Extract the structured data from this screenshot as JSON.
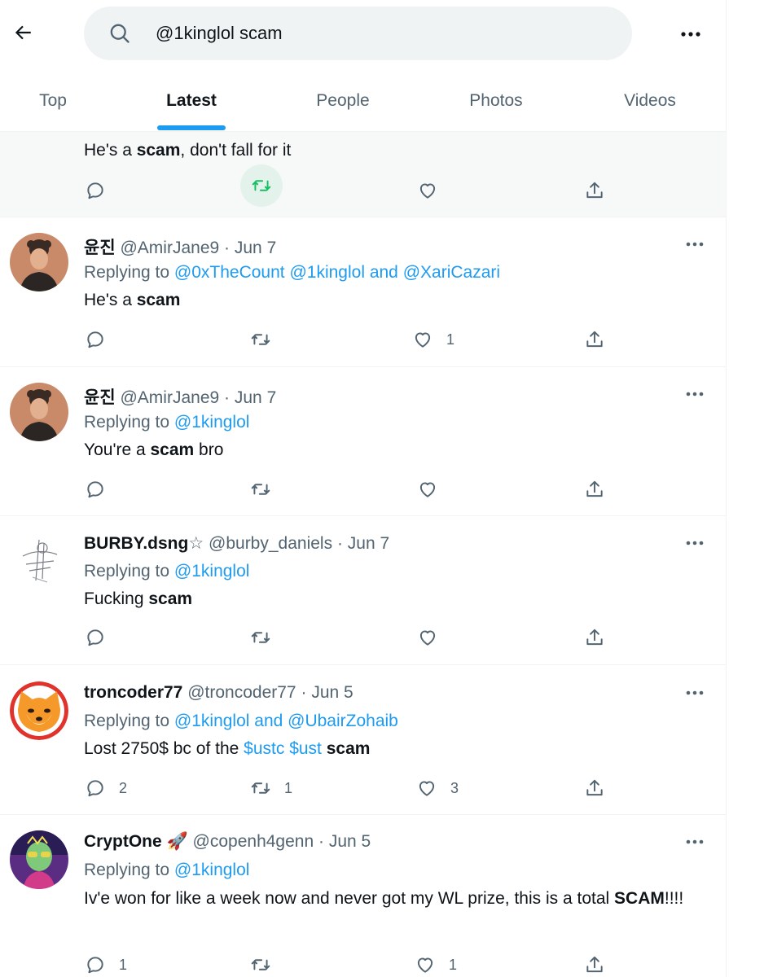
{
  "search": {
    "query": "@1kinglol scam"
  },
  "tabs": [
    "Top",
    "Latest",
    "People",
    "Photos",
    "Videos"
  ],
  "colors": {
    "accent": "#1d9bf0",
    "text": "#0f1419",
    "muted": "#536471",
    "retweet_hover": "#e3f3ec"
  },
  "icons": {
    "back": "arrow-left-icon",
    "search": "search-icon",
    "more": "more-horizontal-icon",
    "reply": "reply-icon",
    "retweet": "retweet-icon",
    "like": "heart-icon",
    "share": "share-icon"
  },
  "tweets": [
    {
      "id": "partial",
      "body": [
        {
          "t": "He's a "
        },
        {
          "b": "scam"
        },
        {
          "t": ", don't fall for it"
        }
      ],
      "counts": {
        "reply": "",
        "retweet": "",
        "like": ""
      }
    },
    {
      "name": "윤진",
      "handle": "@AmirJane9",
      "date": "Jun 7",
      "replying_prefix": "Replying to",
      "replying_to": "@0xTheCount @1kinglol and @XariCazari",
      "body": [
        {
          "t": "He's a "
        },
        {
          "b": "scam"
        }
      ],
      "counts": {
        "reply": "",
        "retweet": "",
        "like": "1"
      }
    },
    {
      "name": "윤진",
      "handle": "@AmirJane9",
      "date": "Jun 7",
      "replying_prefix": "Replying to",
      "replying_to": "@1kinglol",
      "body": [
        {
          "t": "You're a "
        },
        {
          "b": "scam"
        },
        {
          "t": " bro"
        }
      ],
      "counts": {
        "reply": "",
        "retweet": "",
        "like": ""
      }
    },
    {
      "name": "BURBY.dsng",
      "name_suffix": "☆",
      "handle": "@burby_daniels",
      "date": "Jun 7",
      "replying_prefix": "Replying to",
      "replying_to": "@1kinglol",
      "body": [
        {
          "t": "Fucking "
        },
        {
          "b": "scam"
        }
      ],
      "counts": {
        "reply": "",
        "retweet": "",
        "like": ""
      }
    },
    {
      "name": "troncoder77",
      "handle": "@troncoder77",
      "date": "Jun 5",
      "replying_prefix": "Replying to",
      "replying_to": "@1kinglol and @UbairZohaib",
      "body": [
        {
          "t": "Lost 2750$ bc of the "
        },
        {
          "l": "$ustc"
        },
        {
          "t": " "
        },
        {
          "l": "$ust"
        },
        {
          "t": " "
        },
        {
          "b": "scam"
        }
      ],
      "counts": {
        "reply": "2",
        "retweet": "1",
        "like": "3"
      }
    },
    {
      "name": "CryptOne",
      "name_suffix": "🚀",
      "handle": "@copenh4genn",
      "date": "Jun 5",
      "replying_prefix": "Replying to",
      "replying_to": "@1kinglol",
      "body": [
        {
          "t": "Iv'e won for like a week now and never got my WL prize, this is a total "
        },
        {
          "b": "SCAM"
        },
        {
          "t": "!!!!"
        }
      ],
      "counts": {
        "reply": "1",
        "retweet": "",
        "like": "1"
      }
    }
  ]
}
